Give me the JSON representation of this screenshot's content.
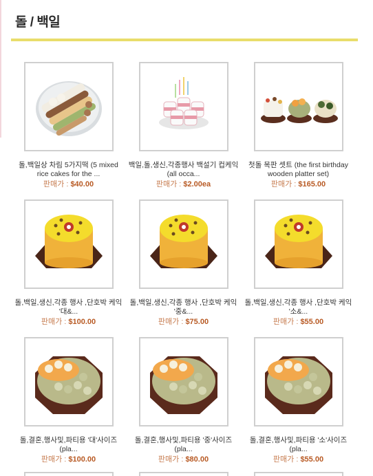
{
  "header": {
    "title": "돌 / 백일"
  },
  "price_label": "판매가 : ",
  "products": [
    {
      "name": "돌,백일상 차림 5가지떡 (5 mixed rice cakes for the ...",
      "price": "$40.00",
      "image": "tiered-platter"
    },
    {
      "name": "백일,돌,생신,각종행사 백설기 컵케익 (all occa...",
      "price": "$2.00ea",
      "image": "cup-cakes"
    },
    {
      "name": "첫돌 목판 셋트 (the first birthday wooden platter set)",
      "price": "$165.00",
      "image": "wooden-platter-set"
    },
    {
      "name": "돌,백일,생신,각종 행사 ,단호박 케익 '대&...",
      "price": "$100.00",
      "image": "pumpkin-cake"
    },
    {
      "name": "돌,백일,생신,각종 행사 ,단호박 케익 '중&...",
      "price": "$75.00",
      "image": "pumpkin-cake"
    },
    {
      "name": "돌,백일,생신,각종 행사 ,단호박 케익 '소&...",
      "price": "$55.00",
      "image": "pumpkin-cake"
    },
    {
      "name": "돌,결혼,행사및,파티용 '대'사이즈 (pla...",
      "price": "$100.00",
      "image": "octagon-platter"
    },
    {
      "name": "돌,결혼,행사및,파티용 '중'사이즈 (pla...",
      "price": "$80.00",
      "image": "octagon-platter"
    },
    {
      "name": "돌,결혼,행사및,파티용 '소'사이즈 (pla...",
      "price": "$55.00",
      "image": "octagon-platter"
    }
  ]
}
